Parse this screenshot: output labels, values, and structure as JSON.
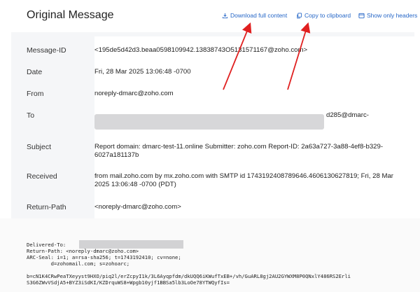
{
  "header": {
    "title": "Original Message",
    "actions": [
      {
        "label": "Download full content",
        "icon": "download-icon"
      },
      {
        "label": "Copy to clipboard",
        "icon": "copy-icon"
      },
      {
        "label": "Show only headers",
        "icon": "headers-icon"
      }
    ]
  },
  "fields": [
    {
      "label": "Message-ID",
      "value": "<195de5d42d3.beaa0598109942.13838743O5131571167@zoho.com>"
    },
    {
      "label": "Date",
      "value": "Fri, 28 Mar 2025 13:06:48 -0700"
    },
    {
      "label": "From",
      "value": "noreply-dmarc@zoho.com"
    },
    {
      "label": "To",
      "value": "d285@dmarc-"
    },
    {
      "label": "Subject",
      "value": "Report domain: dmarc-test-11.online Submitter: zoho.com Report-ID: 2a63a727-3a88-4ef8-b329-6027a181137b"
    },
    {
      "label": "Received",
      "value": "from mail.zoho.com by mx.zoho.com with SMTP id 1743192408789646.4606130627819; Fri, 28 Mar 2025 13:06:48 -0700 (PDT)"
    },
    {
      "label": "Return-Path",
      "value": "<noreply-dmarc@zoho.com>"
    }
  ],
  "raw_headers": "Delivered-To:\nReturn-Path: <noreply-dmarc@zoho.com>\nARC-Seal: i=1; a=rsa-sha256; t=1743192410; cv=none;\n        d=zohomail.com; s=zohoarc;\n\nb=cN1K4CRwPeaTXeyyst9HXO/piq2l/erZcpyI1k/3L6Ayqpfdm/dkUQQ6iKWufTxEB+/vh/GuARL8gj2AU2GYWXM8P0QNxlY486RS2Erli\nS3G6ZWvVSdjA5+BYZ3iSdKI/KZDrquWS8+Wpgb10yjf1BBSa5lb3LoOe78YTWQyfIs=",
  "colors": {
    "accent": "#2566c7",
    "arrow": "#e02020"
  }
}
